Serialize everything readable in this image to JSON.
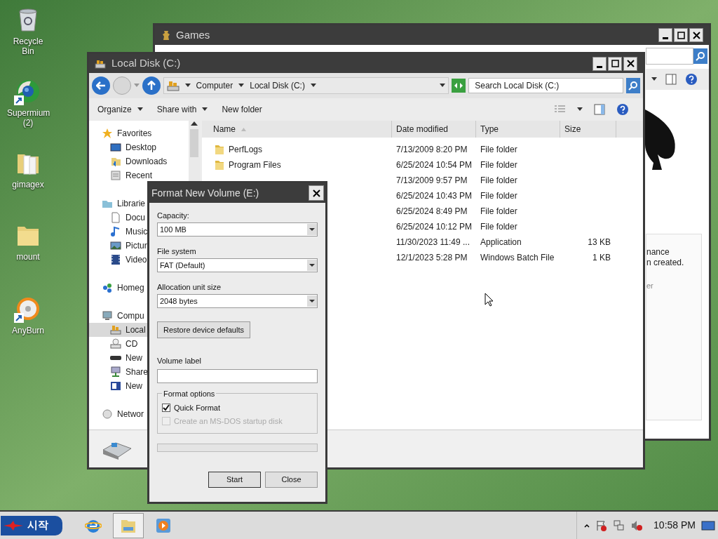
{
  "desktop_icons": [
    {
      "label": "Recycle Bin",
      "kind": "recycle",
      "shortcut": false
    },
    {
      "label": "Supermium (2)",
      "kind": "browser",
      "shortcut": true
    },
    {
      "label": "gimagex",
      "kind": "folder-files",
      "shortcut": false
    },
    {
      "label": "mount",
      "kind": "folder",
      "shortcut": false
    },
    {
      "label": "AnyBurn",
      "kind": "disc",
      "shortcut": true
    }
  ],
  "games_window": {
    "title": "Games",
    "text_fragments": [
      {
        "text": "nance",
        "dim": false
      },
      {
        "text": "n created.",
        "dim": false
      },
      {
        "text": "er",
        "dim": true
      }
    ]
  },
  "explorer": {
    "title": "Local Disk (C:)",
    "breadcrumb": [
      "Computer",
      "Local Disk (C:)"
    ],
    "search": {
      "placeholder": "Search Local Disk (C:)"
    },
    "commands": [
      {
        "label": "Organize",
        "dropdown": true
      },
      {
        "label": "Share with",
        "dropdown": true
      },
      {
        "label": "New folder",
        "dropdown": false
      }
    ],
    "nav": [
      {
        "label": "Favorites",
        "kind": "star",
        "selected": false,
        "children": [
          {
            "label": "Desktop",
            "kind": "desktop",
            "selected": false
          },
          {
            "label": "Downloads",
            "kind": "downloads",
            "selected": false
          },
          {
            "label": "Recent",
            "kind": "recent",
            "selected": false
          }
        ]
      },
      {
        "label": "Librarie",
        "kind": "library",
        "selected": false,
        "children": [
          {
            "label": "Docu",
            "kind": "document",
            "selected": false
          },
          {
            "label": "Music",
            "kind": "music",
            "selected": false
          },
          {
            "label": "Pictur",
            "kind": "picture",
            "selected": false
          },
          {
            "label": "Video",
            "kind": "video",
            "selected": false
          }
        ]
      },
      {
        "label": "Homeg",
        "kind": "homegroup",
        "selected": false
      },
      {
        "label": "Compu",
        "kind": "computer",
        "selected": false,
        "children": [
          {
            "label": "Local",
            "kind": "drive",
            "selected": true
          },
          {
            "label": "CD",
            "kind": "cd",
            "selected": false
          },
          {
            "label": "New",
            "kind": "removable",
            "selected": false
          },
          {
            "label": "Share",
            "kind": "share",
            "selected": false
          },
          {
            "label": "New",
            "kind": "volume",
            "selected": false
          }
        ]
      },
      {
        "label": "Networ",
        "kind": "network",
        "selected": false
      }
    ],
    "columns": [
      "Name",
      "Date modified",
      "Type",
      "Size"
    ],
    "rows": [
      {
        "name": "PerfLogs",
        "date": "7/13/2009 8:20 PM",
        "type": "File folder"
      },
      {
        "name": "Program Files",
        "date": "6/25/2024 10:54 PM",
        "type": "File folder"
      },
      {
        "date": "7/13/2009 9:57 PM",
        "type": "File folder"
      },
      {
        "date": "6/25/2024 10:43 PM",
        "type": "File folder"
      },
      {
        "date": "6/25/2024 8:49 PM",
        "type": "File folder"
      },
      {
        "date": "6/25/2024 10:12 PM",
        "type": "File folder"
      },
      {
        "date": "11/30/2023 11:49 ...",
        "type": "Application",
        "size": "13 KB"
      },
      {
        "date": "12/1/2023 5:28 PM",
        "type": "Windows Batch File",
        "size": "1 KB"
      }
    ]
  },
  "dialog": {
    "title": "Format New Volume (E:)",
    "dropdowns": [
      {
        "label": "Capacity:",
        "value": "100 MB"
      },
      {
        "label": "File system",
        "value": "FAT (Default)"
      },
      {
        "label": "Allocation unit size",
        "value": "2048 bytes"
      }
    ],
    "restore_button": "Restore device defaults",
    "volume_label": {
      "label": "Volume label"
    },
    "format_options": {
      "title": "Format options",
      "checkboxes": [
        {
          "label": "Quick Format",
          "checked": true,
          "disabled": false
        },
        {
          "label": "Create an MS-DOS startup disk",
          "checked": false,
          "disabled": true
        }
      ]
    },
    "progress": {
      "level": 0
    },
    "buttons": [
      "Start",
      "Close"
    ]
  },
  "taskbar": {
    "start": "시작",
    "pinned": [
      {
        "kind": "browser-e",
        "active": false
      },
      {
        "kind": "explorer",
        "active": true
      },
      {
        "kind": "media",
        "active": false
      }
    ],
    "tray": [
      {
        "kind": "flag"
      },
      {
        "kind": "network"
      },
      {
        "kind": "volume"
      }
    ],
    "clock": "10:58 PM"
  }
}
